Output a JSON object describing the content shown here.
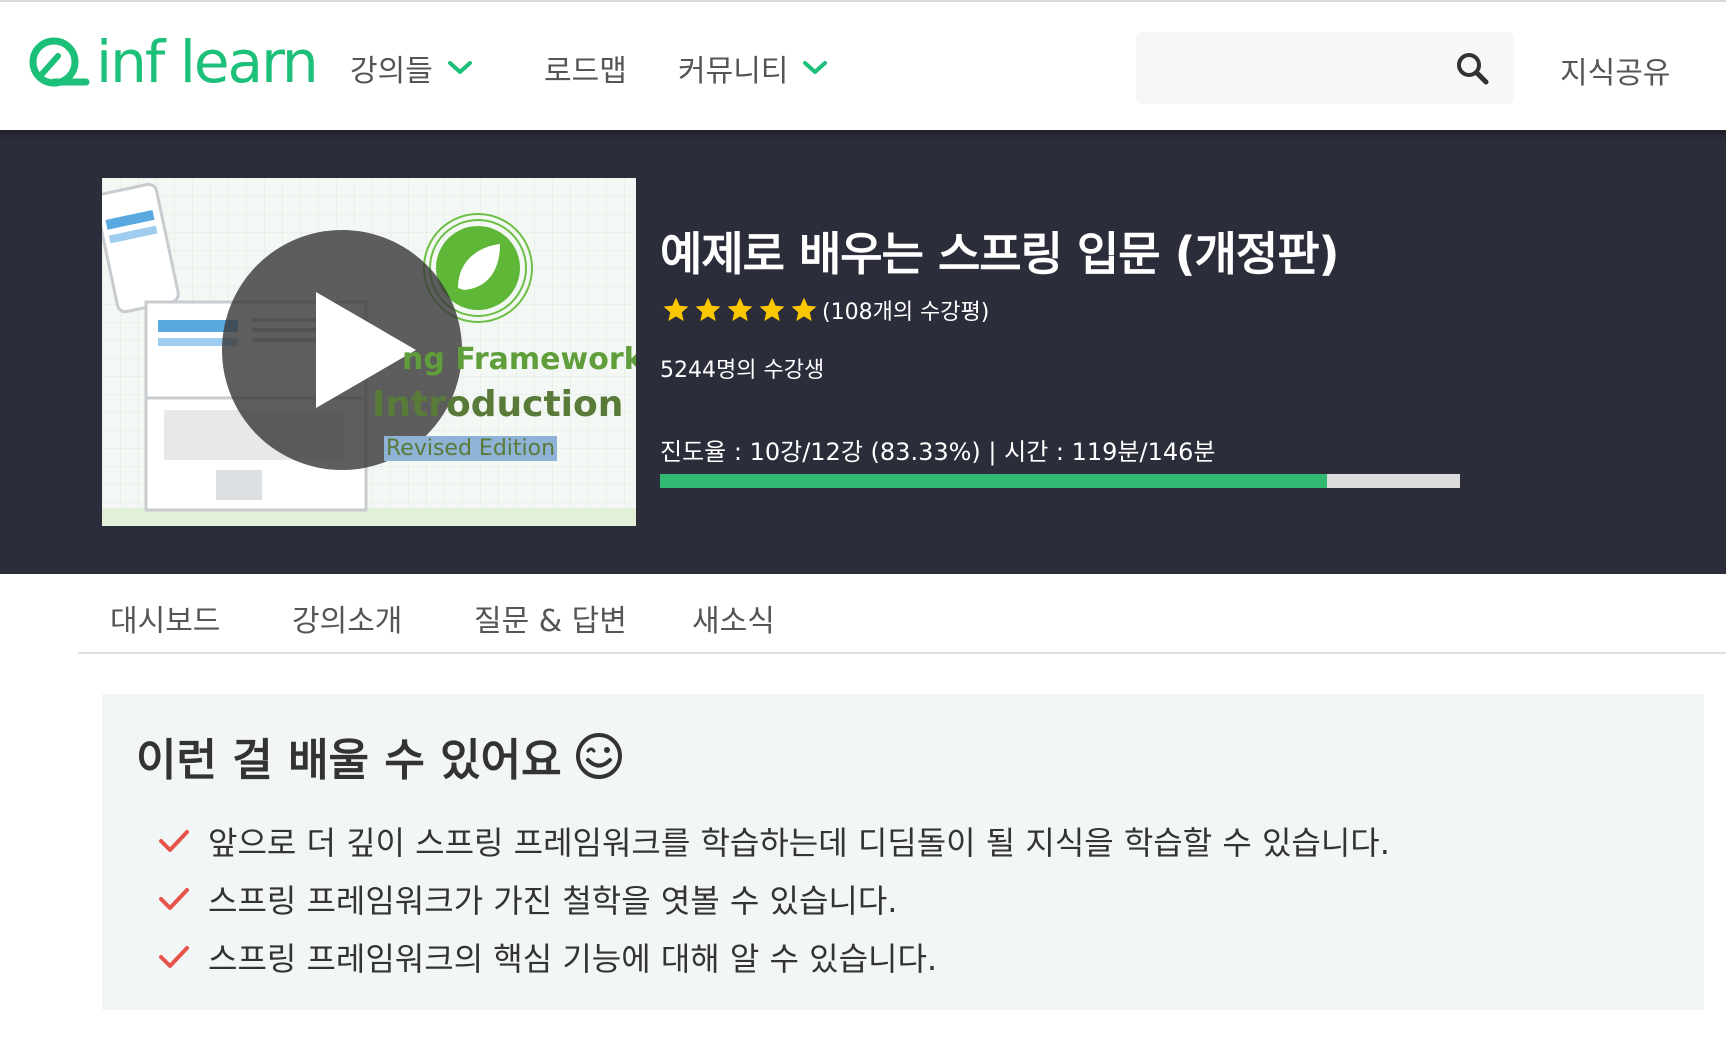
{
  "colors": {
    "brand": "#1dc078",
    "hero_bg": "#2b2d3a",
    "progress_fill": "#31b972",
    "star": "#fdc700",
    "check": "#e5534b"
  },
  "header": {
    "logo_text": "inf learn",
    "nav": [
      {
        "label": "강의들",
        "dropdown": true
      },
      {
        "label": "로드맵",
        "dropdown": false
      },
      {
        "label": "커뮤니티",
        "dropdown": true
      }
    ],
    "search": {
      "value": "",
      "placeholder": "",
      "icon": "search-icon"
    },
    "share_label": "지식공유"
  },
  "course": {
    "thumbnail": {
      "line1": "ng Framework",
      "line2": "Introduction",
      "line3": "Revised Edition"
    },
    "title": "예제로 배우는 스프링 입문 (개정판)",
    "rating": 5,
    "review_count": "(108개의 수강평)",
    "students": "5244명의 수강생",
    "progress_text": "진도율 : 10강/12강 (83.33%) | 시간 : 119분/146분",
    "progress_percent": 83.33
  },
  "tabs": [
    "대시보드",
    "강의소개",
    "질문 & 답변",
    "새소식"
  ],
  "learn": {
    "title": "이런 걸 배울 수 있어요",
    "items": [
      "앞으로 더 깊이 스프링 프레임워크를 학습하는데 디딤돌이 될 지식을 학습할 수 있습니다.",
      "스프링 프레임워크가 가진 철학을 엿볼 수 있습니다.",
      "스프링 프레임워크의 핵심 기능에 대해 알 수 있습니다."
    ]
  }
}
